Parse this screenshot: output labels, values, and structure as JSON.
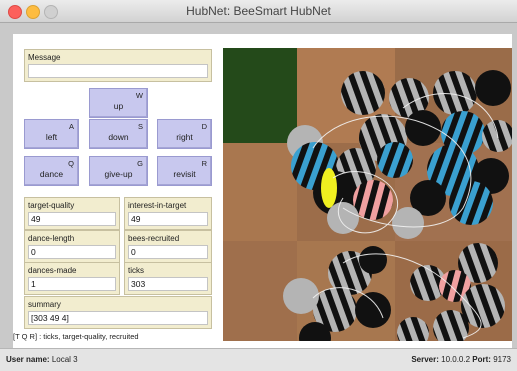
{
  "window": {
    "title": "HubNet: BeeSmart HubNet"
  },
  "message": {
    "label": "Message",
    "value": ""
  },
  "buttons": {
    "up": {
      "label": "up",
      "key": "W"
    },
    "left": {
      "label": "left",
      "key": "A"
    },
    "down": {
      "label": "down",
      "key": "S"
    },
    "right": {
      "label": "right",
      "key": "D"
    },
    "dance": {
      "label": "dance",
      "key": "Q"
    },
    "give_up": {
      "label": "give-up",
      "key": "G"
    },
    "revisit": {
      "label": "revisit",
      "key": "R"
    }
  },
  "monitors": {
    "target_quality": {
      "label": "target-quality",
      "value": "49"
    },
    "interest_in_target": {
      "label": "interest-in-target",
      "value": "49"
    },
    "dance_length": {
      "label": "dance-length",
      "value": "0"
    },
    "bees_recruited": {
      "label": "bees-recruited",
      "value": "0"
    },
    "dances_made": {
      "label": "dances-made",
      "value": "1"
    },
    "ticks": {
      "label": "ticks",
      "value": "303"
    },
    "summary": {
      "label": "summary",
      "value": "[303 49 4]"
    }
  },
  "summary_legend": "[T   Q   R] : ticks, target-quality, recruited",
  "status": {
    "user_label": "User name:",
    "user_value": "Local 3",
    "server_label": "Server:",
    "server_value": "10.0.0.2",
    "port_label": "Port:",
    "port_value": "9173"
  },
  "colors": {
    "button_fill": "#c8c8ee",
    "panel_fill": "#f2edcf",
    "hive_dark_green": "#244a1a",
    "ground_brown": "#a5754f",
    "bee_blue": "#3aa0d0",
    "bee_pink": "#f0a0a0",
    "bee_yellow": "#f0f020"
  }
}
